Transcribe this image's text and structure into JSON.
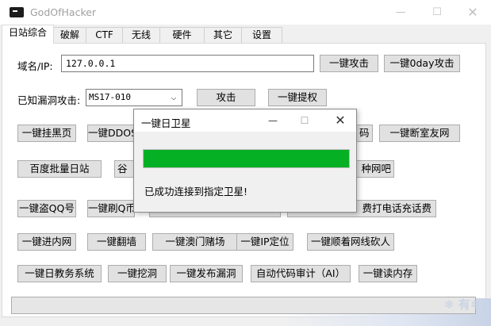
{
  "window": {
    "title": "GodOfHacker",
    "minimize": "—",
    "maximize": "☐",
    "close": "✕"
  },
  "tabs": [
    "日站综合",
    "破解",
    "CTF",
    "无线",
    "硬件",
    "其它",
    "设置"
  ],
  "form": {
    "domain_label": "域名/IP:",
    "domain_value": "127.0.0.1",
    "vuln_label": "已知漏洞攻击:",
    "vuln_selected": "MS17-010",
    "combo_arrow": "⌵"
  },
  "buttons": {
    "one_click_attack": "一键攻击",
    "one_click_0day": "一键0day攻击",
    "attack": "攻击",
    "one_click_privesc": "一键提权",
    "deface": "一键挂黑页",
    "ddos": "一键DDOS",
    "partial_r2": "码",
    "cut_roommate_net": "一键断室友网",
    "baidu_batch": "百度批量日站",
    "partial_r3a": "谷",
    "partial_r3b": "种网吧",
    "steal_qq": "一键盗QQ号",
    "brush_q": "一键刷Q币",
    "free_call": "费打电话充话费",
    "intranet": "一键进内网",
    "vpn": "一键翻墙",
    "macau_casino": "一键澳门赌场",
    "ip_locate": "一键IP定位",
    "follow_cable": "一键顺着网线砍人",
    "edu_system": "一键日教务系统",
    "dig_hole": "一键挖洞",
    "publish_vuln": "一键发布漏洞",
    "code_audit": "自动代码审计（AI）",
    "read_memory": "一键读内存"
  },
  "dialog": {
    "title": "一键日卫星",
    "minimize": "—",
    "maximize": "☐",
    "close": "✕",
    "progress": 1.0,
    "message": "已成功连接到指定卫星!"
  },
  "statusbar": {
    "watermark": "❄ 有❄"
  },
  "colors": {
    "progress": "#06b025"
  }
}
